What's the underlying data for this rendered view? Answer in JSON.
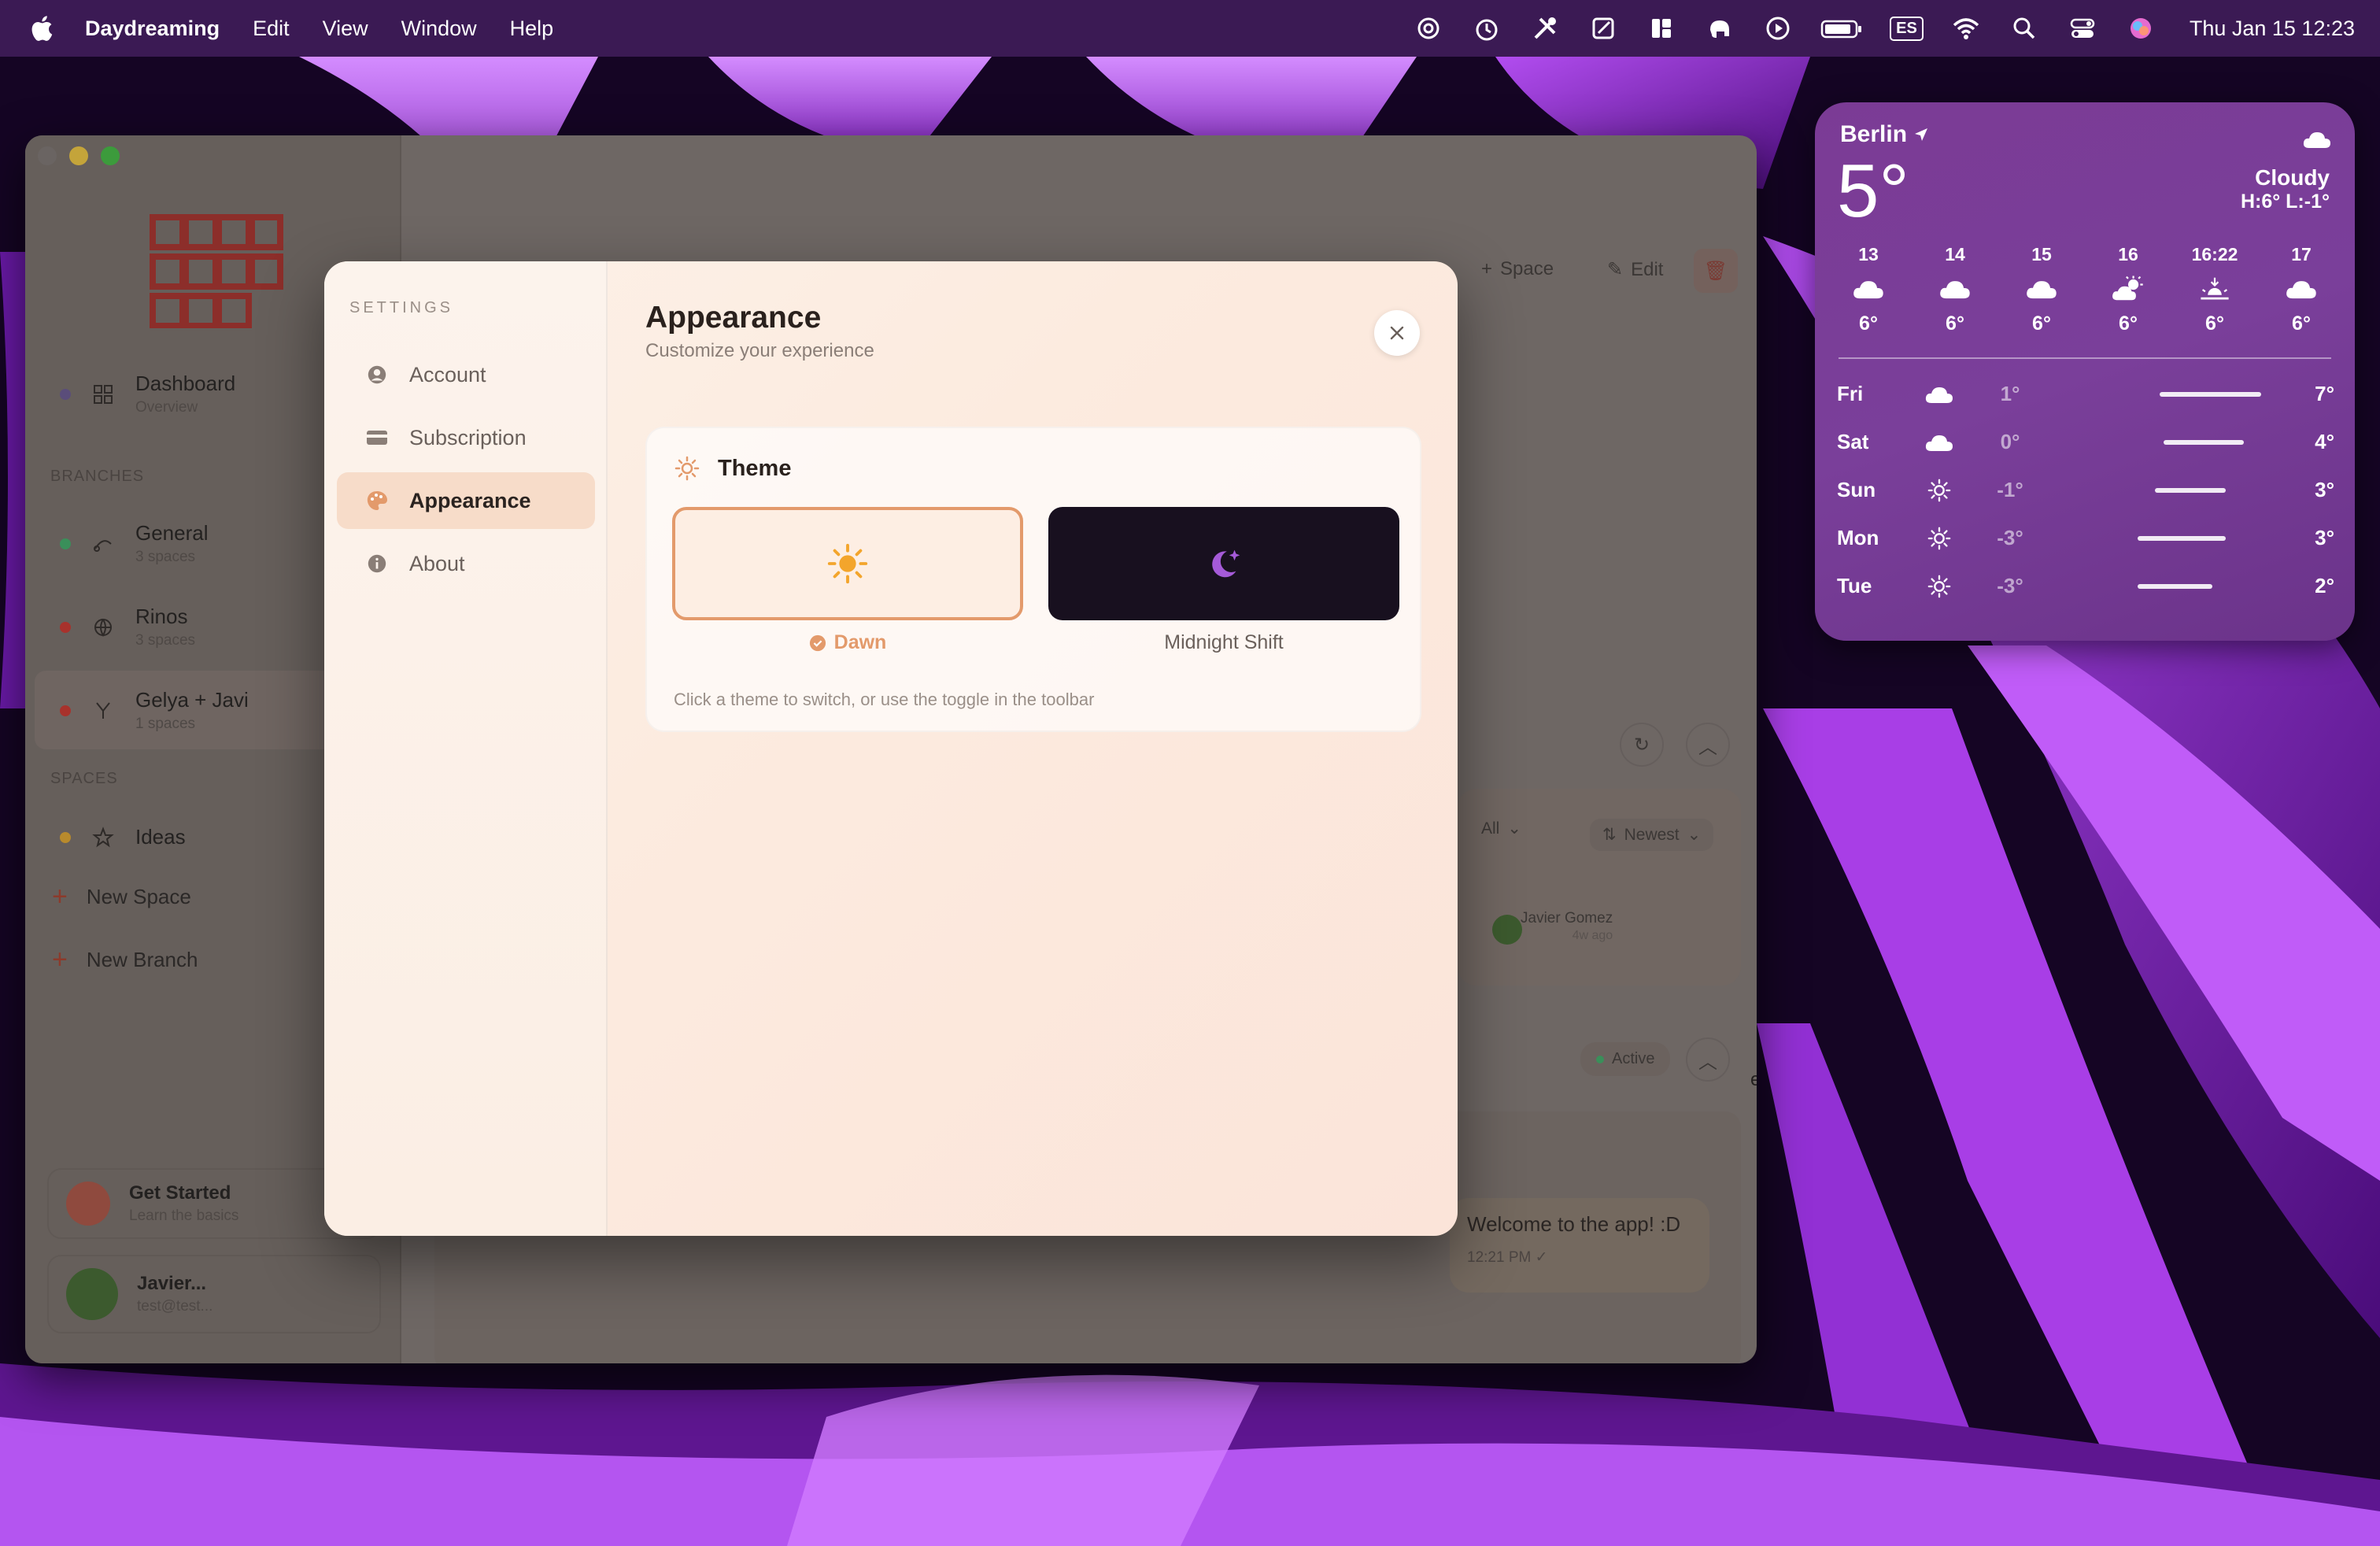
{
  "menubar": {
    "app_name": "Daydreaming",
    "menus": [
      "Edit",
      "View",
      "Window",
      "Help"
    ],
    "status_icons": [
      "openai-icon",
      "timer-icon",
      "tools-icon",
      "note-icon",
      "tiles-icon",
      "elephant-icon",
      "play-icon",
      "battery-icon",
      "input-source-icon",
      "wifi-icon",
      "search-icon",
      "control-center-icon",
      "siri-icon"
    ],
    "input_source": "ES",
    "clock": "Thu Jan 15  12:23"
  },
  "sidebar": {
    "dashboard": {
      "label": "Dashboard",
      "sub": "Overview"
    },
    "branches_label": "BRANCHES",
    "branches": [
      {
        "label": "General",
        "sub": "3 spaces",
        "color": "#3a8f5a"
      },
      {
        "label": "Rinos",
        "sub": "3 spaces",
        "color": "#a8322c"
      },
      {
        "label": "Gelya + Javi",
        "sub": "1 spaces",
        "color": "#a8322c"
      }
    ],
    "spaces_label": "SPACES",
    "spaces": [
      {
        "label": "Ideas",
        "color": "#b88a2c"
      }
    ],
    "new_space": "New Space",
    "new_branch": "New Branch",
    "get_started": {
      "title": "Get Started",
      "sub": "Learn the basics"
    },
    "user": {
      "name": "Javier...",
      "email": "test@test..."
    }
  },
  "background": {
    "title_partial": "Gelya + Javi",
    "space_btn": "Space",
    "edit_btn": "Edit",
    "filter_all": "All",
    "sort": "Newest",
    "author": "Javier Gomez",
    "author_time": "4w ago",
    "active_badge": "Active",
    "message": "Welcome to the app! :D",
    "message_time": "12:21 PM ✓",
    "side_fragment": "er"
  },
  "settings": {
    "heading": "SETTINGS",
    "items": [
      {
        "label": "Account",
        "icon": "user-circle-icon"
      },
      {
        "label": "Subscription",
        "icon": "credit-card-icon"
      },
      {
        "label": "Appearance",
        "icon": "palette-icon"
      },
      {
        "label": "About",
        "icon": "info-icon"
      }
    ],
    "active": "Appearance",
    "title": "Appearance",
    "subtitle": "Customize your experience",
    "theme": {
      "heading": "Theme",
      "options": [
        {
          "label": "Dawn",
          "selected": true
        },
        {
          "label": "Midnight Shift",
          "selected": false
        }
      ],
      "hint": "Click a theme to switch, or use the toggle in the toolbar"
    }
  },
  "weather": {
    "city": "Berlin",
    "temp": "5°",
    "condition": "Cloudy",
    "high_low": "H:6° L:-1°",
    "hourly": [
      {
        "time": "13",
        "icon": "cloud-icon",
        "temp": "6°"
      },
      {
        "time": "14",
        "icon": "cloud-icon",
        "temp": "6°"
      },
      {
        "time": "15",
        "icon": "cloud-icon",
        "temp": "6°"
      },
      {
        "time": "16",
        "icon": "partly-sunny-icon",
        "temp": "6°"
      },
      {
        "time": "16:22",
        "icon": "sunset-icon",
        "temp": "6°"
      },
      {
        "time": "17",
        "icon": "cloud-icon",
        "temp": "6°"
      }
    ],
    "daily": [
      {
        "day": "Fri",
        "icon": "cloud-icon",
        "low": "1°",
        "high": "7°",
        "range": [
          0.46,
          0.92
        ]
      },
      {
        "day": "Sat",
        "icon": "cloud-icon",
        "low": "0°",
        "high": "4°",
        "range": [
          0.48,
          0.84
        ]
      },
      {
        "day": "Sun",
        "icon": "sun-icon",
        "low": "-1°",
        "high": "3°",
        "range": [
          0.44,
          0.76
        ]
      },
      {
        "day": "Mon",
        "icon": "sun-icon",
        "low": "-3°",
        "high": "3°",
        "range": [
          0.36,
          0.76
        ]
      },
      {
        "day": "Tue",
        "icon": "sun-icon",
        "low": "-3°",
        "high": "2°",
        "range": [
          0.36,
          0.7
        ]
      }
    ]
  },
  "colors": {
    "accent": "#e39a6b",
    "modal_bg": "#fcebdf",
    "midnight": "#18101f",
    "weather": "#7a3f9a"
  }
}
